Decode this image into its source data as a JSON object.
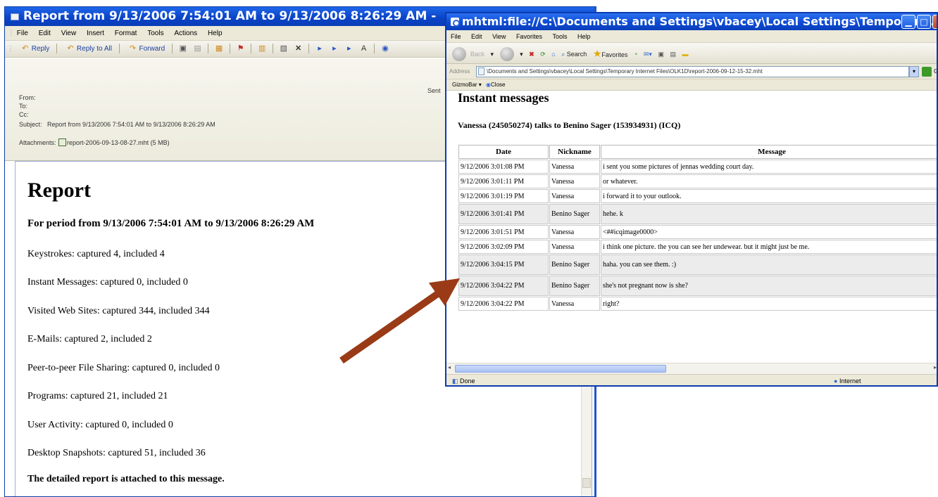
{
  "outlook": {
    "title": "Report from 9/13/2006 7:54:01 AM to 9/13/2006 8:26:29 AM -",
    "menu": [
      "File",
      "Edit",
      "View",
      "Insert",
      "Format",
      "Tools",
      "Actions",
      "Help"
    ],
    "toolbar": {
      "reply": "Reply",
      "reply_all": "Reply to All",
      "forward": "Forward"
    },
    "header": {
      "from_label": "From:",
      "to_label": "To:",
      "cc_label": "Cc:",
      "subject_label": "Subject:",
      "subject": "Report from 9/13/2006 7:54:01 AM to 9/13/2006 8:26:29 AM",
      "attachments_label": "Attachments:",
      "attachment": "report-2006-09-13-08-27.mht (5 MB)",
      "sent_label": "Sent"
    },
    "body": {
      "title": "Report",
      "period": "For period from 9/13/2006 7:54:01 AM to 9/13/2006 8:26:29 AM",
      "lines": [
        "Keystrokes: captured 4, included 4",
        "Instant Messages: captured 0, included 0",
        "Visited Web Sites: captured 344, included 344",
        "E-Mails: captured 2, included 2",
        "Peer-to-peer File Sharing: captured 0, included 0",
        "Programs: captured 21, included 21",
        "User Activity: captured 0, included 0",
        "Desktop Snapshots: captured 51, included 36"
      ],
      "footer": "The detailed report is attached to this message."
    }
  },
  "ie": {
    "title": "mhtml:file://C:\\Documents and Settings\\vbacey\\Local Settings\\Temporary...",
    "menu": [
      "File",
      "Edit",
      "View",
      "Favorites",
      "Tools",
      "Help"
    ],
    "toolbar": {
      "back": "Back",
      "search": "Search",
      "favorites": "Favorites"
    },
    "address_label": "Address",
    "address": "\\Documents and Settings\\vbacey\\Local Settings\\Temporary Internet Files\\OLK1D\\report-2006-09-12-15-32.mht",
    "go": "Go",
    "gizmo": "GizmoBar",
    "close": "Close",
    "heading": "Instant messages",
    "subheading": "Vanessa (245050274) talks to Benino Sager (153934931) (ICQ)",
    "table": {
      "headers": [
        "Date",
        "Nickname",
        "Message"
      ],
      "rows": [
        {
          "date": "9/12/2006 3:01:08 PM",
          "nick": "Vanessa",
          "msg": "i sent you some pictures of jennas wedding court day."
        },
        {
          "date": "9/12/2006 3:01:11 PM",
          "nick": "Vanessa",
          "msg": "or whatever."
        },
        {
          "date": "9/12/2006 3:01:19 PM",
          "nick": "Vanessa",
          "msg": "i forward it to your outlook."
        },
        {
          "date": "9/12/2006 3:01:41 PM",
          "nick": "Benino Sager",
          "msg": "hehe. k"
        },
        {
          "date": "9/12/2006 3:01:51 PM",
          "nick": "Vanessa",
          "msg": "<##icqimage0000>"
        },
        {
          "date": "9/12/2006 3:02:09 PM",
          "nick": "Vanessa",
          "msg": "i think one picture. the you can see her undewear. but it might just be me."
        },
        {
          "date": "9/12/2006 3:04:15 PM",
          "nick": "Benino Sager",
          "msg": "haha. you can see them. :)"
        },
        {
          "date": "9/12/2006 3:04:22 PM",
          "nick": "Benino Sager",
          "msg": "she's not pregnant now is she?"
        },
        {
          "date": "9/12/2006 3:04:22 PM",
          "nick": "Vanessa",
          "msg": "right?"
        }
      ]
    },
    "status": "Done",
    "zone": "Internet"
  },
  "colors": {
    "titlebar": "#0b44c8",
    "arrow": "#9a3a16"
  }
}
